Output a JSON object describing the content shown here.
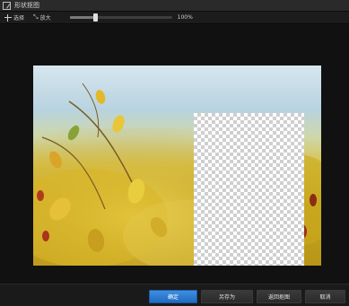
{
  "window": {
    "title": "形状抠图"
  },
  "toolbar": {
    "tool_label": "选择",
    "zoom_label": "放大",
    "zoom_value": "100%",
    "zoom_fraction": 0.25
  },
  "buttons": {
    "confirm": "确定",
    "save_as": "另存为",
    "back": "返回抠图",
    "cancel": "取消"
  },
  "colors": {
    "primary_button": "#2a7bd6",
    "background": "#141414",
    "checker_light": "#ffffff",
    "checker_dark": "#cfcfcf"
  }
}
